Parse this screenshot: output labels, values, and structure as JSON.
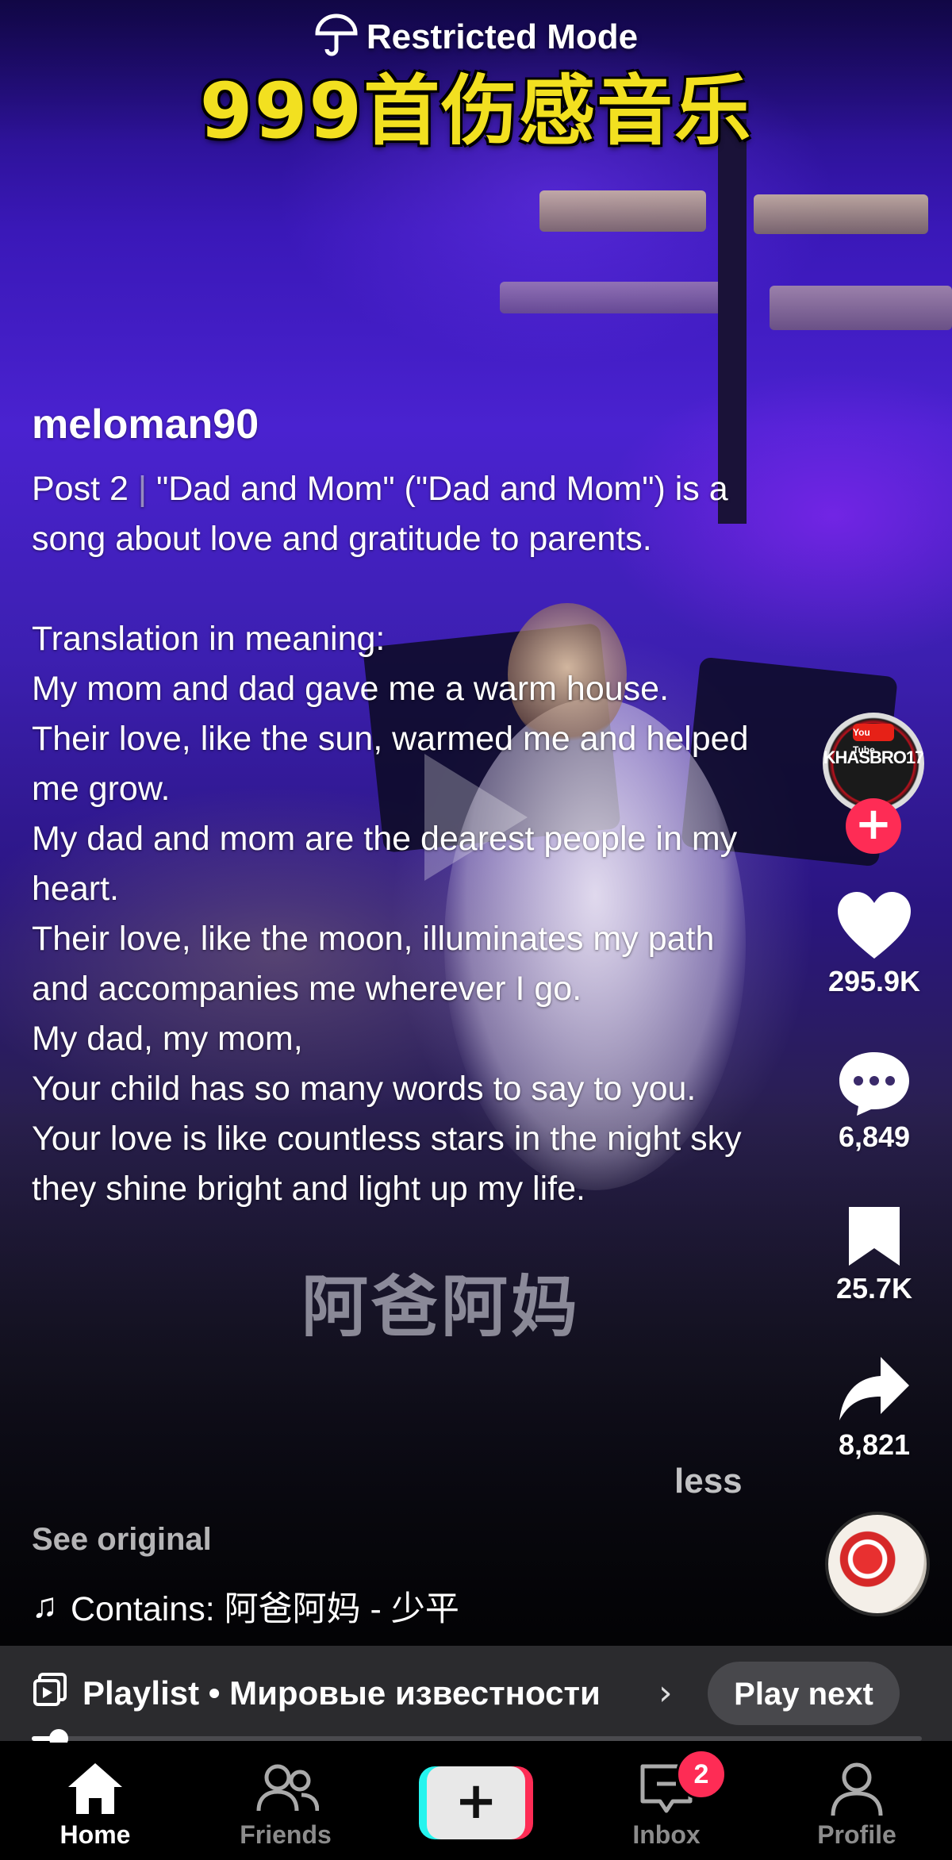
{
  "restricted_mode": "Restricted Mode",
  "video_overlay_title": "999首伤感音乐",
  "video_subtitle": "阿爸阿妈",
  "post": {
    "username": "meloman90",
    "caption": {
      "intro_prefix": "Post 2",
      "intro_sep": "|",
      "intro_rest": "\"Dad and Mom\" (\"Dad and Mom\") is a song about love and gratitude to parents.",
      "translation_header": "Translation in meaning:",
      "lines": [
        "My mom and dad gave me a warm house.",
        "Their love, like the sun, warmed me and helped me grow.",
        "My dad and mom are the dearest people in my heart.",
        "Their love, like the moon, illuminates my path and accompanies me wherever I go.",
        "My dad, my mom,",
        "Your child has so many words to say to you.",
        "Your love is like countless stars in the night sky",
        "they shine bright and light up my life."
      ]
    },
    "less_label": "less",
    "see_original_label": "See original",
    "music": "Contains: 阿爸阿妈 - 少平"
  },
  "rail": {
    "avatar_channel_name": "KHASBRO17",
    "avatar_badge": "You Tube",
    "follow_symbol": "+",
    "likes": "295.9K",
    "comments": "6,849",
    "saves": "25.7K",
    "shares": "8,821"
  },
  "playlist": {
    "label": "Playlist • Мировые известности",
    "chevron": "›",
    "play_next_label": "Play next",
    "progress_fraction": 0.03
  },
  "nav": {
    "home": "Home",
    "friends": "Friends",
    "create_symbol": "+",
    "inbox": "Inbox",
    "inbox_badge": "2",
    "profile": "Profile"
  },
  "colors": {
    "accent_red": "#fe2c55",
    "accent_cyan": "#25f4ee",
    "overlay_yellow": "#f2e020"
  }
}
